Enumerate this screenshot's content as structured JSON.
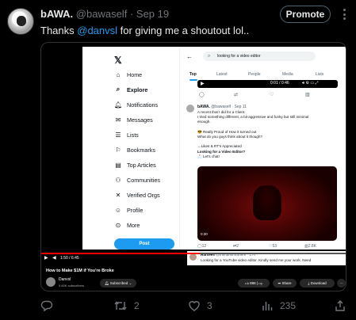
{
  "tweet": {
    "display_name": "bAWA.",
    "handle": "@bawaself",
    "separator": "·",
    "date": "Sep 19",
    "promote_label": "Promote",
    "text_before": "Thanks ",
    "mention": "@danvsl",
    "text_after": " for giving me a shoutout lol..",
    "stats": {
      "retweets": "2",
      "likes": "3",
      "views": "235"
    }
  },
  "video": {
    "x_nav": {
      "logo": "𝕏",
      "items": [
        "Home",
        "Explore",
        "Notifications",
        "Messages",
        "Lists",
        "Bookmarks",
        "Top Articles",
        "Communities",
        "Verified Orgs",
        "Profile",
        "More"
      ],
      "active_item": "Explore",
      "post_label": "Post"
    },
    "search": {
      "query": "looking for a video editor",
      "tabs": [
        "Top",
        "Latest",
        "People",
        "Media",
        "Lists"
      ],
      "active_tab": "Top"
    },
    "mini_player_time": "0:01 / 0:46",
    "inner_tweet": {
      "name": "bAWA.",
      "handle": "@bawaself · Sep 11",
      "lines": [
        "A recent that I did for a Client.",
        "I tried something different, a bit aggressive and funky but still minimal",
        "enough.",
        "",
        "😎 Really Proud of How it turned out",
        "What do you guys think about it though?",
        "",
        "→Likes & RT's Appreciated",
        "Looking for a Video Editor?",
        "📩 Let's chat!"
      ],
      "video_time": "0:30",
      "actions": [
        "12",
        "2",
        "53",
        "2.8K"
      ]
    },
    "peek_tweet": {
      "name": "Harsees",
      "handle": "@theharsimrahere · 17h",
      "text": "Looking for a YouTube video editor. Kindly send me your work. Need"
    },
    "player_time": "1:50 / 6:45",
    "youtube": {
      "title": "How to Make $1M if You're Broke",
      "channel": "Danvsl",
      "subscribers": "4.60K subscribers",
      "subscribe_label": "Subscribed",
      "like_count": "886",
      "share_label": "Share",
      "download_label": "Download"
    }
  }
}
